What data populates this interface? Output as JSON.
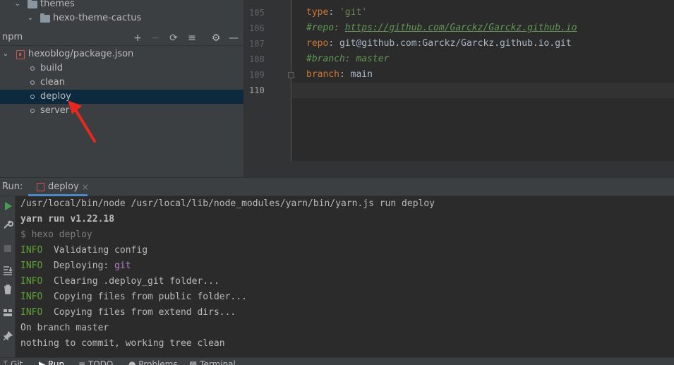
{
  "project_tree": {
    "themes_label": "themes",
    "theme_cactus_label": "hexo-theme-cactus"
  },
  "npm_panel": {
    "title": "npm",
    "package_label": "hexoblog/package.json",
    "scripts": [
      "build",
      "clean",
      "deploy",
      "server"
    ],
    "selected_script": "deploy"
  },
  "editor": {
    "line_numbers": [
      "105",
      "106",
      "107",
      "108",
      "109",
      "110"
    ],
    "current_line": "110",
    "lines": {
      "l105_key": "type",
      "l105_val": "'git'",
      "l106_comment_prefix": "#repo: ",
      "l106_url": "https://github.com/Garckz/Garckz.github.io",
      "l107_key": "repo",
      "l107_val": "git@github.com:Garckz/Garckz.github.io.git",
      "l108_comment": "#branch: master",
      "l109_key": "branch",
      "l109_val": "main"
    }
  },
  "run": {
    "label": "Run:",
    "tab_label": "deploy",
    "console": {
      "line1": "/usr/local/bin/node /usr/local/lib/node_modules/yarn/bin/yarn.js run deploy",
      "line2": "yarn run v1.22.18",
      "line3": "$ hexo deploy",
      "info_tag": "INFO",
      "line4": "  Validating config",
      "line5_text": "  Deploying: ",
      "line5_accent": "git",
      "line6": "  Clearing .deploy_git folder...",
      "line7": "  Copying files from public folder...",
      "line8": "  Copying files from extend dirs...",
      "line9": "On branch master",
      "line10": "nothing to commit, working tree clean"
    }
  },
  "bottom_bar": {
    "git": "Git",
    "run": "Run",
    "todo": "TODO",
    "problems": "Problems",
    "terminal": "Terminal"
  },
  "colors": {
    "selection": "#0d293e",
    "info_green": "#5da338",
    "accent_purple": "#b082c9",
    "annotation_arrow": "#e8281e"
  }
}
